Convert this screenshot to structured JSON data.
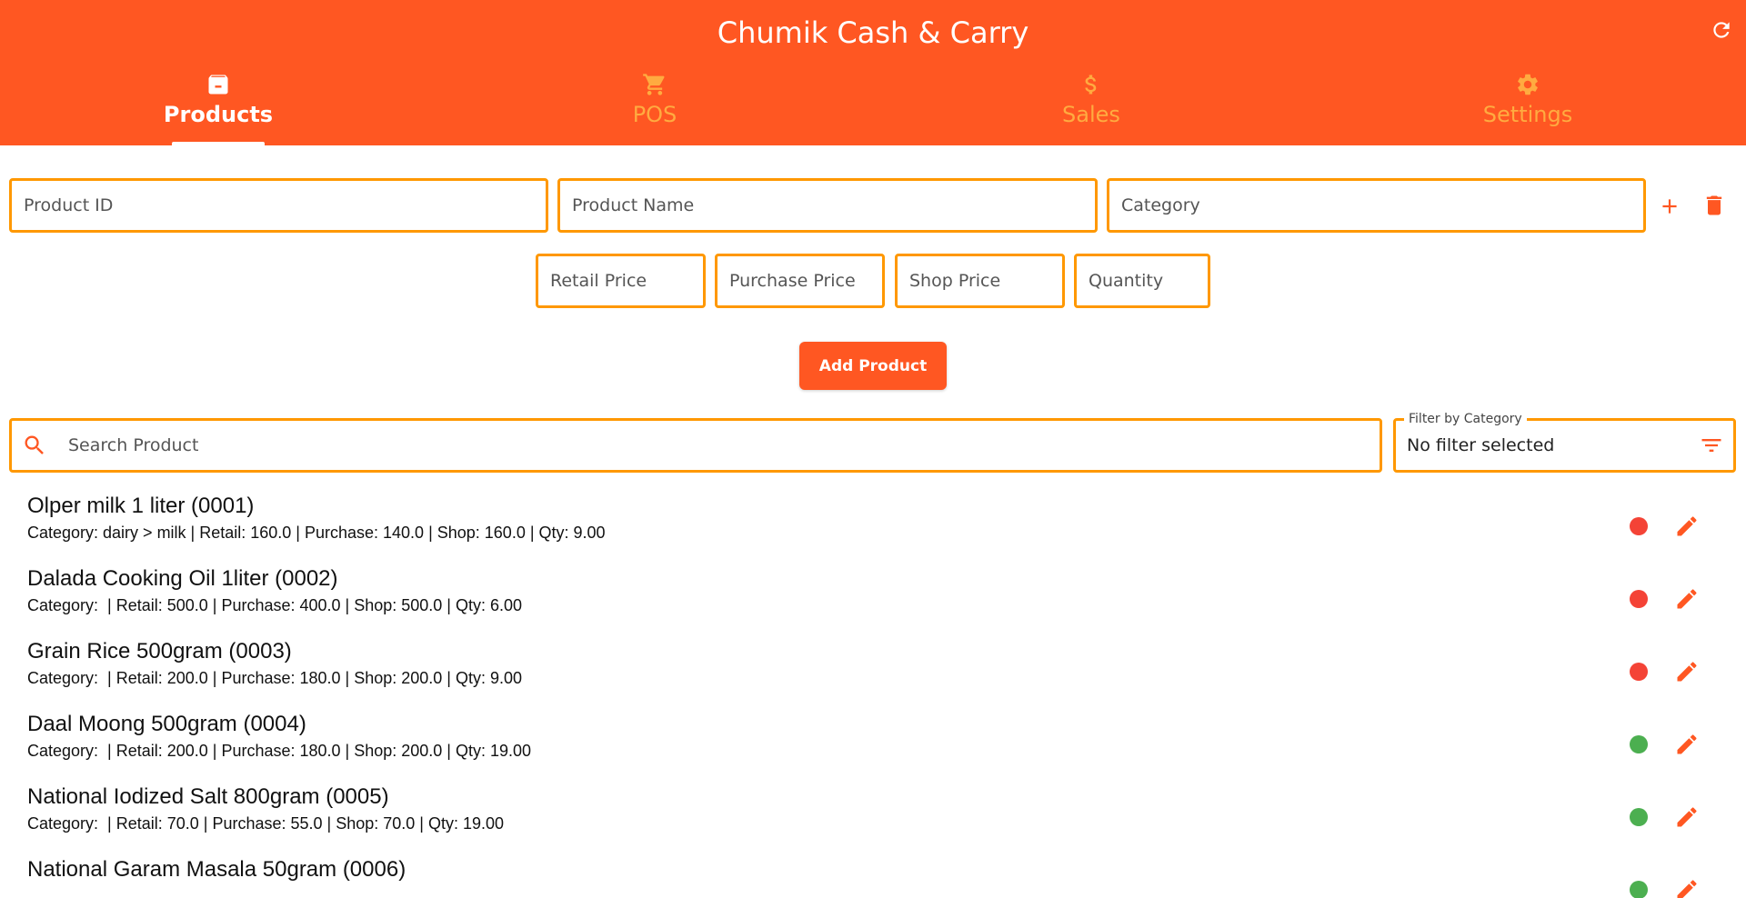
{
  "app": {
    "title": "Chumik Cash & Carry",
    "colors": {
      "primary": "#ff5722",
      "accent": "#ff9800",
      "tab_inactive": "#ffab40",
      "in_stock": "#4caf50",
      "low_stock": "#f44336"
    }
  },
  "header": {
    "refresh_icon": "refresh-icon"
  },
  "tabs": [
    {
      "label": "Products",
      "icon": "archive-box-icon",
      "active": true
    },
    {
      "label": "POS",
      "icon": "cart-icon",
      "active": false
    },
    {
      "label": "Sales",
      "icon": "dollar-icon",
      "active": false
    },
    {
      "label": "Settings",
      "icon": "gear-icon",
      "active": false
    }
  ],
  "form": {
    "product_id_placeholder": "Product ID",
    "product_name_placeholder": "Product Name",
    "category_placeholder": "Category",
    "retail_price_placeholder": "Retail Price",
    "purchase_price_placeholder": "Purchase Price",
    "shop_price_placeholder": "Shop Price",
    "quantity_placeholder": "Quantity",
    "add_category_icon": "plus-icon",
    "delete_category_icon": "trash-icon",
    "add_button_label": "Add Product"
  },
  "search": {
    "placeholder": "Search Product",
    "icon": "search-icon"
  },
  "filter": {
    "legend": "Filter by Category",
    "value": "No filter selected",
    "icon": "filter-list-icon"
  },
  "products": [
    {
      "title": "Olper milk 1 liter (0001)",
      "details": "Category: dairy > milk | Retail: 160.0 | Purchase: 140.0 | Shop: 160.0 | Qty: 9.00",
      "status": "low"
    },
    {
      "title": "Dalada Cooking Oil 1liter (0002)",
      "details": "Category:  | Retail: 500.0 | Purchase: 400.0 | Shop: 500.0 | Qty: 6.00",
      "status": "low"
    },
    {
      "title": "Grain Rice 500gram (0003)",
      "details": "Category:  | Retail: 200.0 | Purchase: 180.0 | Shop: 200.0 | Qty: 9.00",
      "status": "low"
    },
    {
      "title": "Daal Moong 500gram (0004)",
      "details": "Category:  | Retail: 200.0 | Purchase: 180.0 | Shop: 200.0 | Qty: 19.00",
      "status": "ok"
    },
    {
      "title": "National Iodized Salt 800gram (0005)",
      "details": "Category:  | Retail: 70.0 | Purchase: 55.0 | Shop: 70.0 | Qty: 19.00",
      "status": "ok"
    },
    {
      "title": "National Garam Masala 50gram (0006)",
      "details": "",
      "status": "ok"
    }
  ]
}
